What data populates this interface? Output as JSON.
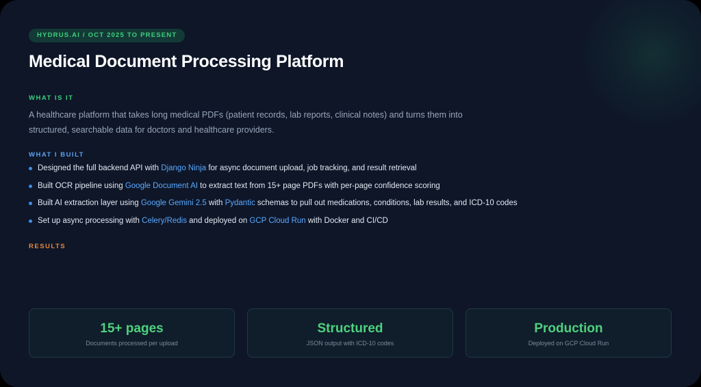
{
  "header": {
    "badge": "HYDRUS.AI / OCT 2025 TO PRESENT",
    "title": "Medical Document Processing Platform"
  },
  "what_is_it": {
    "label": "WHAT IS IT",
    "description": "A healthcare platform that takes long medical PDFs (patient records, lab reports, clinical notes) and turns them into structured, searchable data for doctors and healthcare providers."
  },
  "what_i_built": {
    "label": "WHAT I BUILT",
    "items": [
      {
        "before": "Designed the full backend API with ",
        "h1": "Django Ninja",
        "mid": " for async document upload, job tracking, and result retrieval",
        "h2": "",
        "after": ""
      },
      {
        "before": "Built OCR pipeline using ",
        "h1": "Google Document AI",
        "mid": " to extract text from 15+ page PDFs with per-page confidence scoring",
        "h2": "",
        "after": ""
      },
      {
        "before": "Built AI extraction layer using ",
        "h1": "Google Gemini 2.5",
        "mid": " with ",
        "h2": "Pydantic",
        "after": " schemas to pull out medications, conditions, lab results, and ICD-10 codes"
      },
      {
        "before": "Set up async processing with ",
        "h1": "Celery/Redis",
        "mid": " and deployed on ",
        "h2": "GCP Cloud Run",
        "after": " with Docker and CI/CD"
      }
    ]
  },
  "results": {
    "label": "RESULTS",
    "stats": [
      {
        "value": "15+ pages",
        "caption": "Documents processed per upload"
      },
      {
        "value": "Structured",
        "caption": "JSON output with ICD-10 codes"
      },
      {
        "value": "Production",
        "caption": "Deployed on GCP Cloud Run"
      }
    ]
  },
  "colors": {
    "background": "#0e1628",
    "accent_green": "#4fd17f",
    "accent_blue": "#5aa9ff",
    "accent_orange": "#e8873a"
  }
}
